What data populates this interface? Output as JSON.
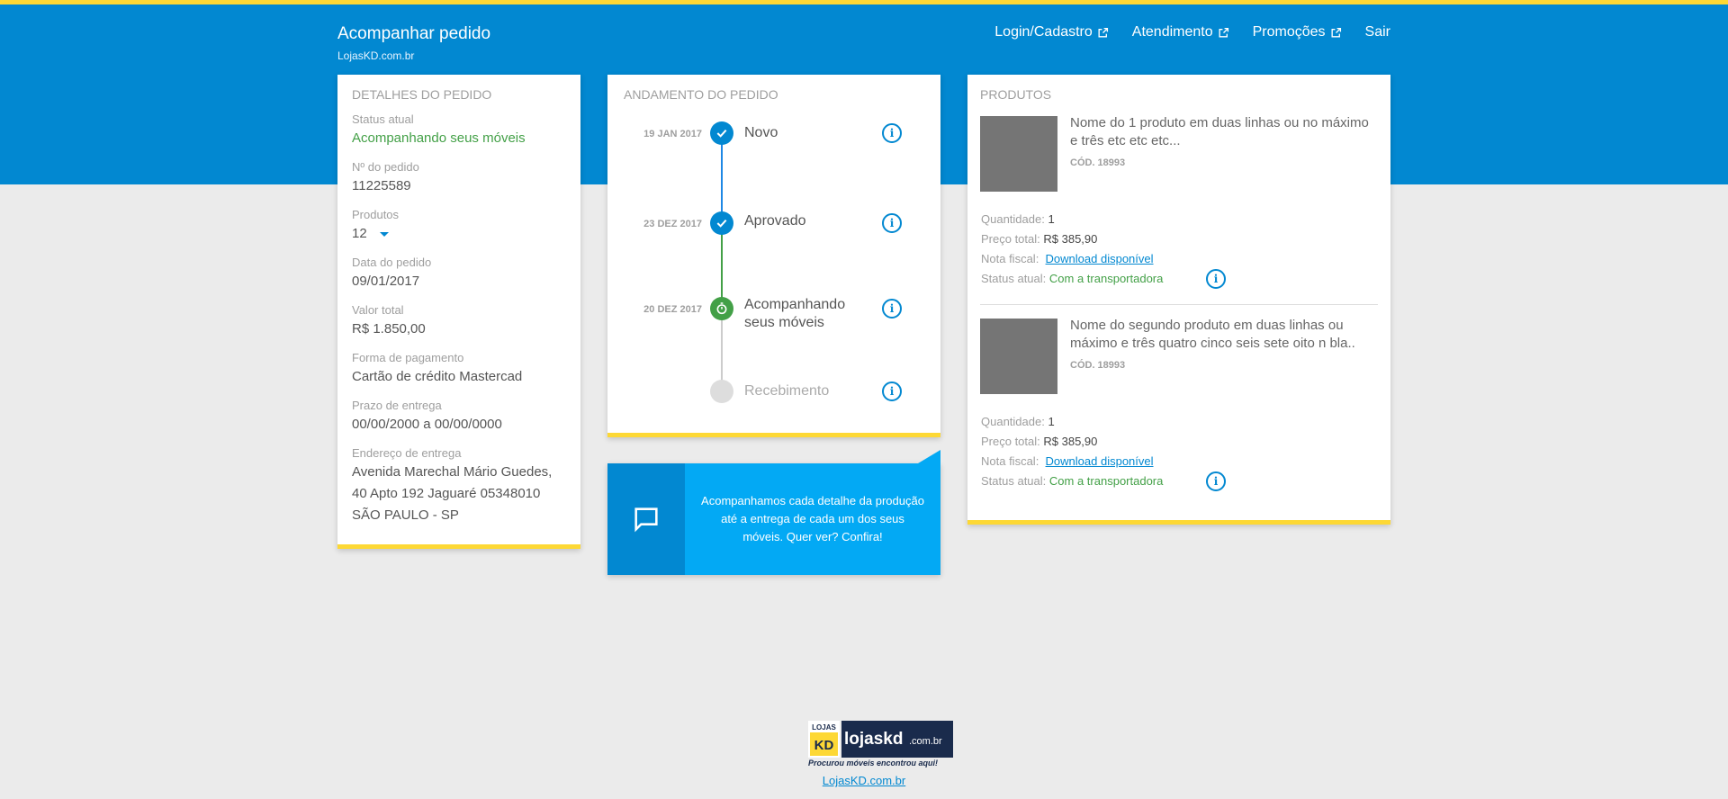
{
  "header": {
    "title": "Acompanhar pedido",
    "subtitle": "LojasKD.com.br",
    "nav": [
      {
        "label": "Login/Cadastro",
        "icon": "external-link-icon"
      },
      {
        "label": "Atendimento",
        "icon": "external-link-icon"
      },
      {
        "label": "Promoções",
        "icon": "external-link-icon"
      },
      {
        "label": "Sair"
      }
    ]
  },
  "details": {
    "title": "DETALHES DO PEDIDO",
    "fields": [
      {
        "label": "Status atual",
        "value": "Acompanhando seus móveis"
      },
      {
        "label": "Nº do pedido",
        "value": "11225589"
      },
      {
        "label": "Produtos",
        "value": "12"
      },
      {
        "label": "Data do pedido",
        "value": "09/01/2017"
      },
      {
        "label": "Valor total",
        "value": "R$ 1.850,00"
      },
      {
        "label": "Forma de pagamento",
        "value": "Cartão de crédito Mastercad"
      },
      {
        "label": "Prazo de entrega",
        "value": "00/00/2000 a 00/00/0000"
      },
      {
        "label": "Endereço de entrega",
        "value": "Avenida Marechal Mário Guedes, 40 Apto 192 Jaguaré 05348010 SÃO PAULO - SP"
      }
    ]
  },
  "progress": {
    "title": "ANDAMENTO DO PEDIDO",
    "steps": [
      {
        "date": "19 JAN 2017",
        "label": "Novo",
        "state": "done",
        "icon": "check-icon"
      },
      {
        "date": "23 DEZ 2017",
        "label": "Aprovado",
        "state": "done",
        "icon": "check-icon"
      },
      {
        "date": "20  DEZ 2017",
        "label": "Acompanhando seus móveis",
        "state": "current",
        "icon": "timer-icon"
      },
      {
        "date": "",
        "label": "Recebimento",
        "state": "pending",
        "icon": ""
      }
    ]
  },
  "banner": {
    "text": "Acompanhamos cada detalhe da produção até a entrega de cada um dos seus móveis. Quer ver? Confira!",
    "icon": "chat-icon"
  },
  "products": {
    "title": "PRODUTOS",
    "labels": {
      "quantity": "Quantidade:",
      "price": "Preço total:",
      "invoice": "Nota fiscal:",
      "status": "Status atual:"
    },
    "items": [
      {
        "name": "Nome do 1 produto em duas linhas ou no máximo e três etc etc etc...",
        "code": "CÓD. 18993",
        "quantity": "1",
        "price": "R$ 385,90",
        "invoice": "Download disponível",
        "status": "Com a transportadora"
      },
      {
        "name": "Nome do segundo produto em duas linhas ou máximo e três quatro cinco seis sete oito n bla..",
        "code": "CÓD. 18993",
        "quantity": "1",
        "price": "R$ 385,90",
        "invoice": "Download disponível",
        "status": "Com a transportadora"
      }
    ]
  },
  "footer": {
    "logo_small": "LOJAS",
    "logo_kd": "KD",
    "logo_main": "lojaskd",
    "logo_domain": ".com.br",
    "logo_tagline": "Procurou móveis encontrou aqui!",
    "link": "LojasKD.com.br"
  },
  "colors": {
    "primary": "#0288d1",
    "accent": "#fdd835",
    "success": "#43a047",
    "banner": "#03a9f4"
  }
}
